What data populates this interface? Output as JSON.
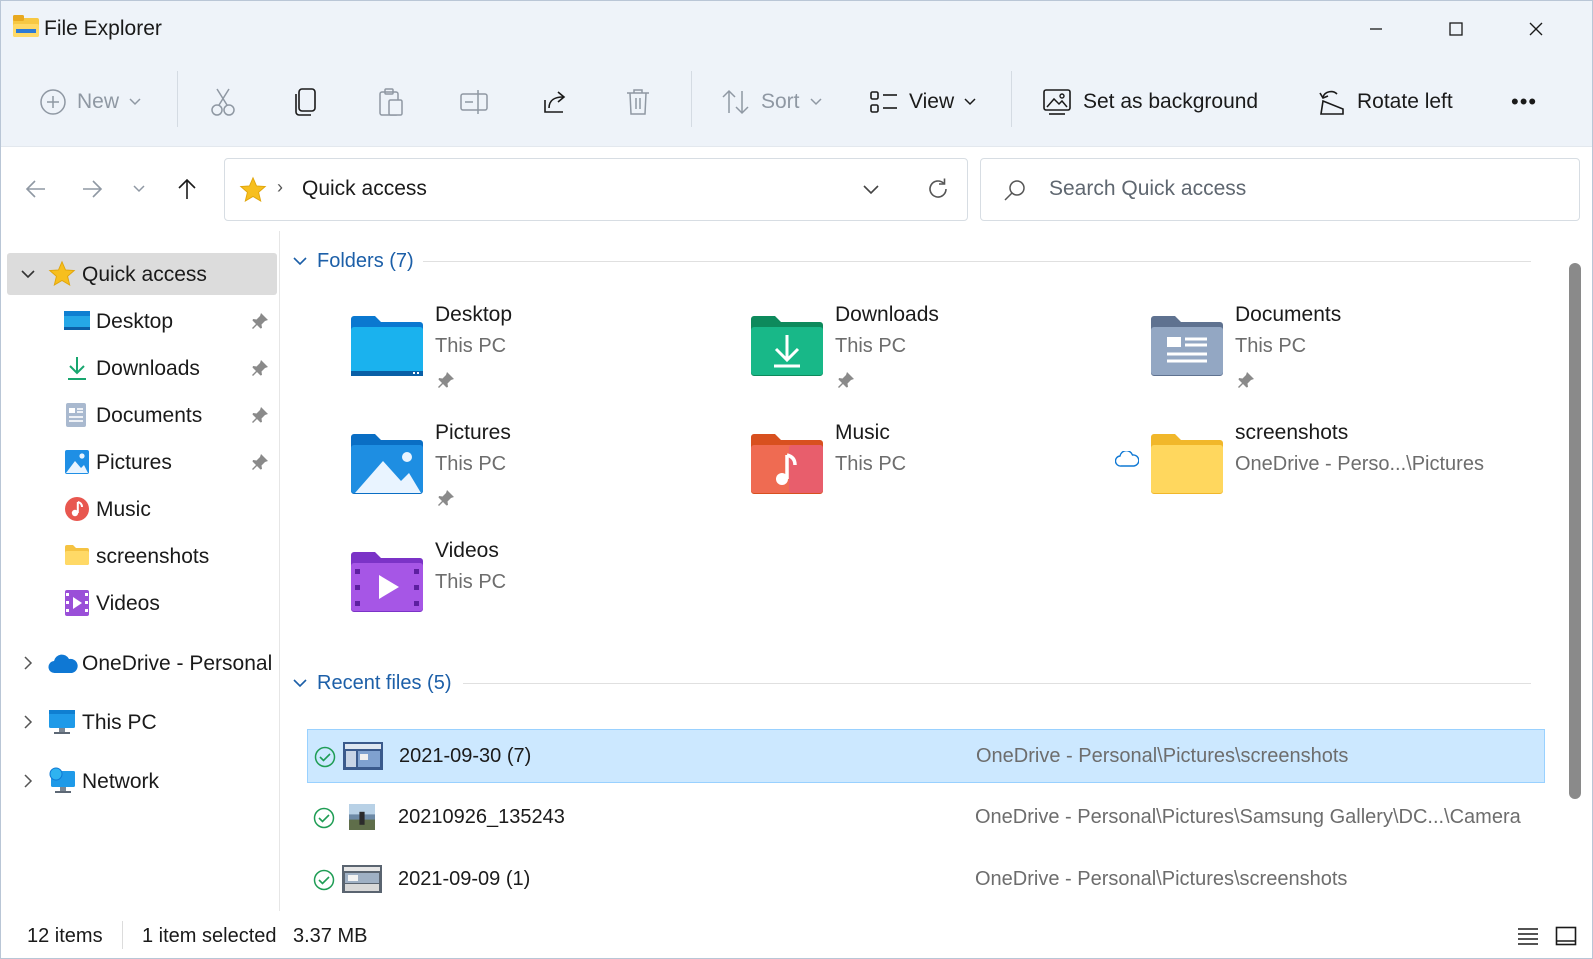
{
  "window": {
    "title": "File Explorer"
  },
  "toolbar": {
    "new_label": "New",
    "sort_label": "Sort",
    "view_label": "View",
    "set_bg_label": "Set as background",
    "rotate_left_label": "Rotate left",
    "more_label": "•••"
  },
  "address": {
    "location": "Quick access",
    "separator": "›"
  },
  "search": {
    "placeholder": "Search Quick access"
  },
  "sidebar": {
    "quick_access": "Quick access",
    "items": [
      {
        "label": "Desktop",
        "pinned": true
      },
      {
        "label": "Downloads",
        "pinned": true
      },
      {
        "label": "Documents",
        "pinned": true
      },
      {
        "label": "Pictures",
        "pinned": true
      },
      {
        "label": "Music",
        "pinned": false
      },
      {
        "label": "screenshots",
        "pinned": false
      },
      {
        "label": "Videos",
        "pinned": false
      }
    ],
    "onedrive": "OneDrive - Personal",
    "this_pc": "This PC",
    "network": "Network"
  },
  "folders_group": {
    "header": "Folders (7)",
    "tiles": [
      {
        "name": "Desktop",
        "location": "This PC",
        "icon": "desktop-folder-icon"
      },
      {
        "name": "Downloads",
        "location": "This PC",
        "icon": "downloads-folder-icon"
      },
      {
        "name": "Documents",
        "location": "This PC",
        "icon": "documents-folder-icon"
      },
      {
        "name": "Pictures",
        "location": "This PC",
        "icon": "pictures-folder-icon"
      },
      {
        "name": "Music",
        "location": "This PC",
        "icon": "music-folder-icon"
      },
      {
        "name": "screenshots",
        "location": "OneDrive - Perso...\\Pictures",
        "icon": "yellow-folder-icon"
      },
      {
        "name": "Videos",
        "location": "This PC",
        "icon": "videos-folder-icon"
      }
    ]
  },
  "recent_group": {
    "header": "Recent files (5)",
    "files": [
      {
        "name": "2021-09-30 (7)",
        "path": "OneDrive - Personal\\Pictures\\screenshots",
        "selected": true
      },
      {
        "name": "20210926_135243",
        "path": "OneDrive - Personal\\Pictures\\Samsung Gallery\\DC...\\Camera",
        "selected": false
      },
      {
        "name": "2021-09-09 (1)",
        "path": "OneDrive - Personal\\Pictures\\screenshots",
        "selected": false
      }
    ]
  },
  "status": {
    "items_count": "12 items",
    "selection": "1 item selected",
    "size": "3.37 MB"
  },
  "colors": {
    "accent": "#1c5fa8",
    "selection_bg": "#cce8ff",
    "chrome_bg": "#eef3f9"
  }
}
